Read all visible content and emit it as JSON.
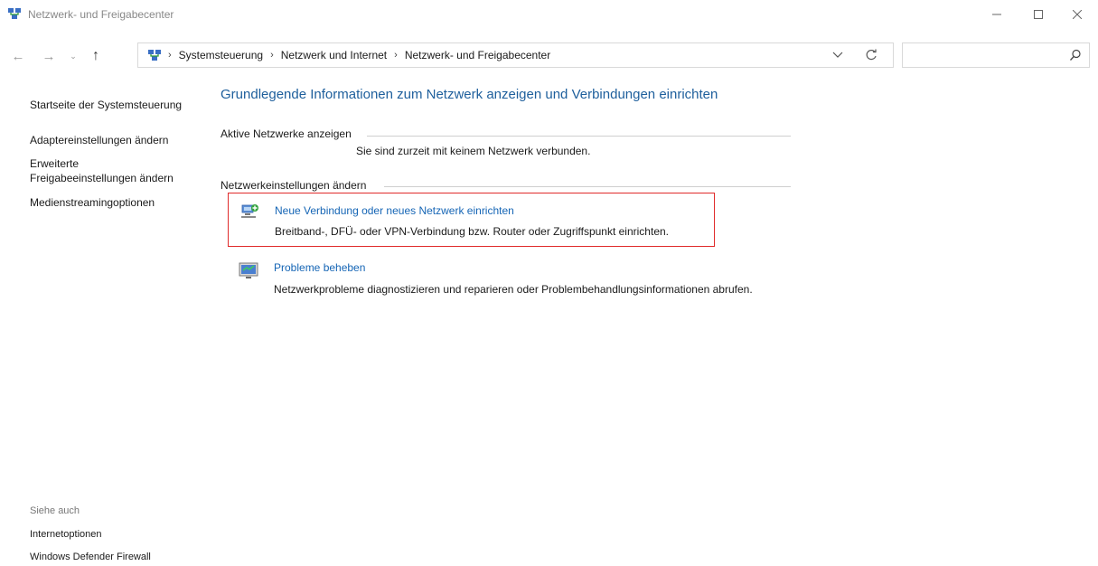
{
  "window": {
    "title": "Netzwerk- und Freigabecenter"
  },
  "navigation": {
    "breadcrumbs": [
      "Systemsteuerung",
      "Netzwerk und Internet",
      "Netzwerk- und Freigabecenter"
    ],
    "search_placeholder": ""
  },
  "sidebar": {
    "items": [
      "Startseite der Systemsteuerung",
      "Adaptereinstellungen ändern",
      "Erweiterte Freigabeeinstellungen ändern",
      "Medienstreamingoptionen"
    ],
    "advanced_sharing_line1": "Erweiterte",
    "advanced_sharing_line2": "Freigabeeinstellungen ändern",
    "see_also": {
      "title": "Siehe auch",
      "items": [
        "Internetoptionen",
        "Windows Defender Firewall"
      ]
    }
  },
  "main": {
    "title": "Grundlegende Informationen zum Netzwerk anzeigen und Verbindungen einrichten",
    "active_networks_label": "Aktive Netzwerke anzeigen",
    "no_network_text": "Sie sind zurzeit mit keinem Netzwerk verbunden.",
    "change_settings_label": "Netzwerkeinstellungen ändern",
    "tasks": [
      {
        "link": "Neue Verbindung oder neues Netzwerk einrichten",
        "description": "Breitband-, DFÜ- oder VPN-Verbindung bzw. Router oder Zugriffspunkt einrichten.",
        "icon": "network-setup-icon",
        "highlighted": true
      },
      {
        "link": "Probleme beheben",
        "description": "Netzwerkprobleme diagnostizieren und reparieren oder Problembehandlungsinformationen abrufen.",
        "icon": "troubleshoot-icon",
        "highlighted": false
      }
    ]
  },
  "colors": {
    "title_blue": "#1e5f9c",
    "link_blue": "#1565b5",
    "highlight_red": "#e02b2b"
  }
}
